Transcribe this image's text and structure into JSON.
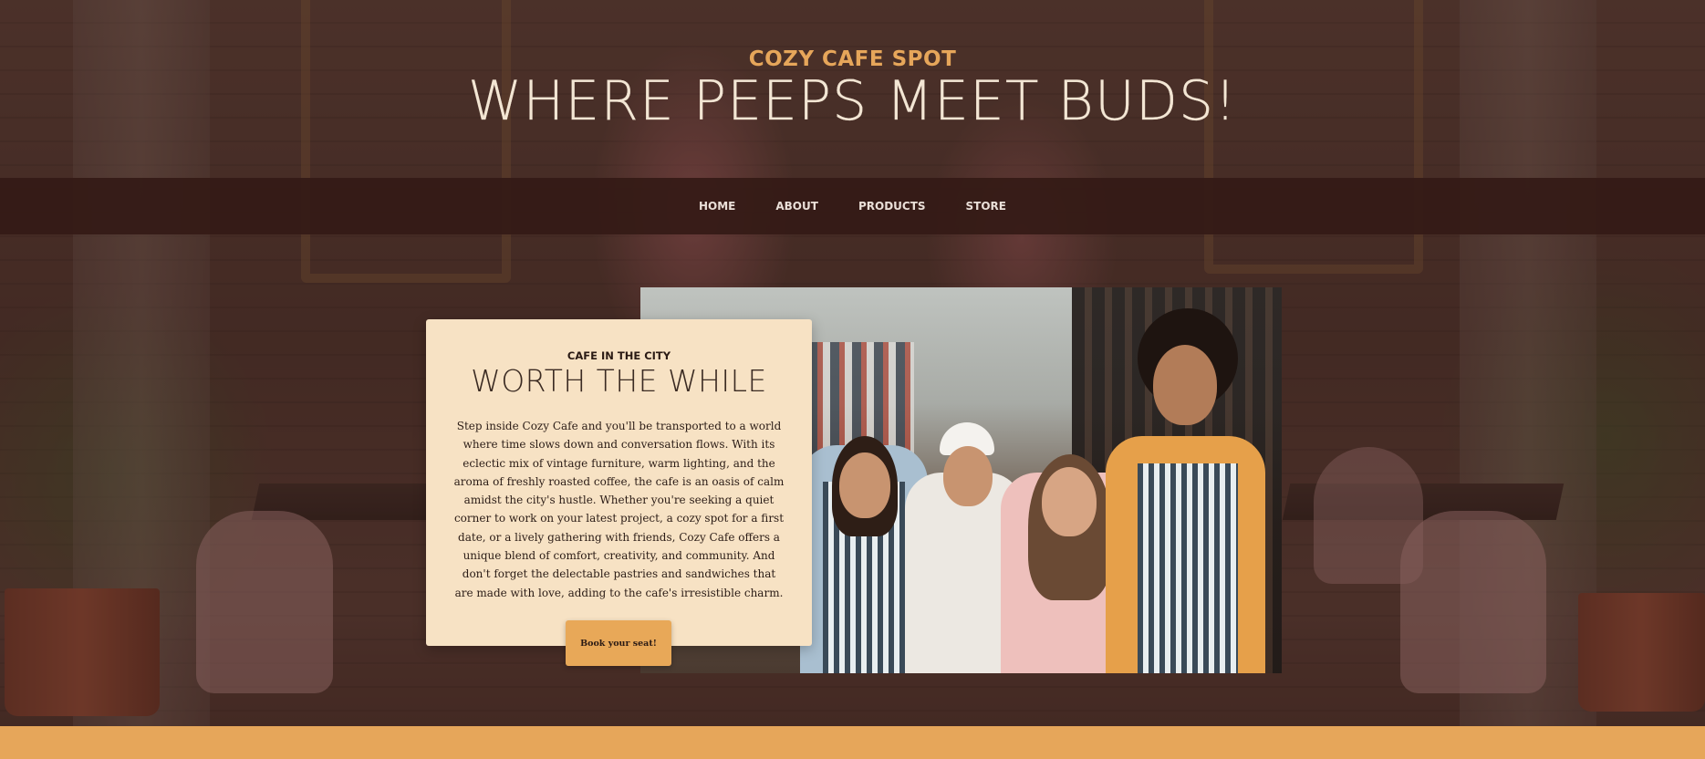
{
  "header": {
    "eyebrow": "COZY CAFE SPOT",
    "headline": "WHERE PEEPS MEET BUDS!"
  },
  "nav": {
    "items": [
      {
        "label": "HOME"
      },
      {
        "label": "ABOUT"
      },
      {
        "label": "PRODUCTS"
      },
      {
        "label": "STORE"
      }
    ]
  },
  "intro": {
    "eyebrow": "CAFE IN THE CITY",
    "title": "WORTH THE WHILE",
    "body": "Step inside Cozy Cafe and you'll be transported to a world where time slows down and conversation flows. With its eclectic mix of vintage furniture, warm lighting, and the aroma of freshly roasted coffee, the cafe is an oasis of calm amidst the city's hustle. Whether you're seeking a quiet corner to work on your latest project, a cozy spot for a first date, or a lively gathering with friends, Cozy Cafe offers a unique blend of comfort, creativity, and community. And don't forget the delectable pastries and sandwiches that are made with love, adding to the cafe's irresistible charm.",
    "button_label": "Book your seat!"
  },
  "colors": {
    "accent": "#e6a65a",
    "nav_bg": "#341a16",
    "card_bg": "#f7e2c4",
    "headline": "#f3e6d4"
  },
  "icons": {
    "photo": "cafe-staff-photo"
  }
}
